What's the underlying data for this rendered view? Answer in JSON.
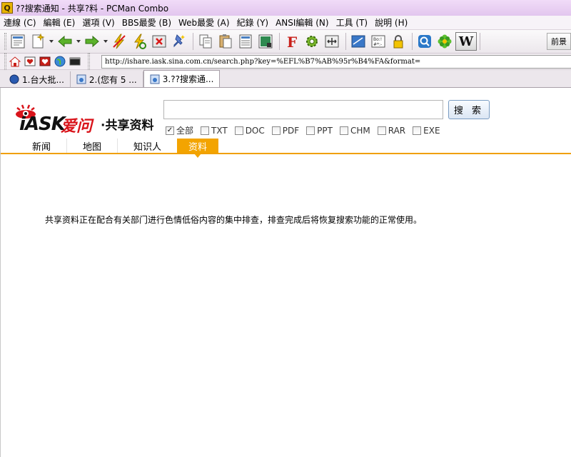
{
  "window": {
    "title": "??搜索通知 - 共享?料 - PCMan Combo",
    "app_icon_letter": "Q"
  },
  "menu": [
    "連線 (C)",
    "編輯 (E)",
    "選項 (V)",
    "BBS最愛 (B)",
    "Web最愛 (A)",
    "紀錄 (Y)",
    "ANSI編輯 (N)",
    "工具 (T)",
    "說明 (H)"
  ],
  "toolbar": {
    "wikipedia_label": "W",
    "right_button": "前景"
  },
  "address": {
    "url": "http://ishare.iask.sina.com.cn/search.php?key=%EFL%B7%AB%95r%B4%FA&format="
  },
  "tabs": [
    {
      "label": "1.台大批..."
    },
    {
      "label": "2.(您有 5 ..."
    },
    {
      "label": "3.??搜索通..."
    }
  ],
  "page": {
    "logo": {
      "iask": "iASK",
      "aiwen": "爱问",
      "share": "·共享资料"
    },
    "search_value": "",
    "search_button": "搜 索",
    "filters": [
      {
        "label": "全部",
        "checked": true
      },
      {
        "label": "TXT",
        "checked": false
      },
      {
        "label": "DOC",
        "checked": false
      },
      {
        "label": "PDF",
        "checked": false
      },
      {
        "label": "PPT",
        "checked": false
      },
      {
        "label": "CHM",
        "checked": false
      },
      {
        "label": "RAR",
        "checked": false
      },
      {
        "label": "EXE",
        "checked": false
      }
    ],
    "nav": [
      {
        "label": "新闻"
      },
      {
        "label": "地图"
      },
      {
        "label": "知识人"
      },
      {
        "label": "资料"
      }
    ],
    "notice": "共享资料正在配合有关部门进行色情低俗内容的集中排查，排查完成后将恢复搜索功能的正常使用。"
  }
}
